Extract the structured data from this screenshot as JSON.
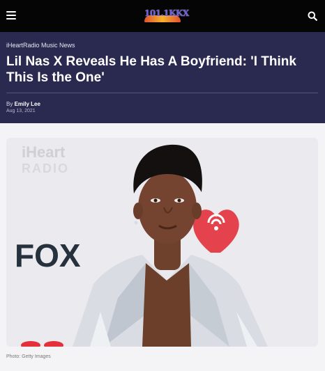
{
  "topbar": {
    "menu_icon": "hamburger-menu-icon",
    "logo_text": "101.1KKX",
    "search_icon": "search-icon"
  },
  "article": {
    "category": "iHeartRadio Music News",
    "title": "Lil Nas X Reveals He Has A Boyfriend: 'I Think This Is the One'",
    "byline_prefix": "By ",
    "author": "Emily Lee",
    "date": "Aug 13, 2021",
    "photo": {
      "backdrop_text_1": "iHeart",
      "backdrop_text_2": "RADIO",
      "backdrop_text_3": "FOX",
      "credit": "Photo: Getty Images"
    }
  },
  "colors": {
    "topbar_bg": "#050505",
    "header_bg": "#2a2950",
    "page_bg": "#f4f4f6",
    "iheart_red": "#e3303a"
  }
}
